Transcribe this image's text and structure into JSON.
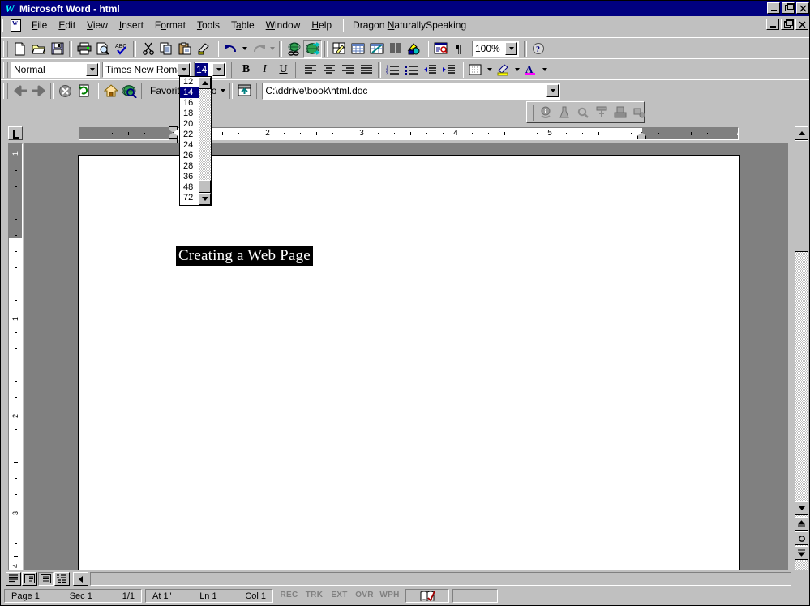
{
  "window": {
    "title": "Microsoft Word - html",
    "app_icon": "word-w-icon",
    "minimize_label": "Minimize",
    "maximize_label": "Maximize",
    "close_label": "Close",
    "doc_minimize_label": "Minimize Document",
    "doc_restore_label": "Restore Document",
    "doc_close_label": "Close Document",
    "titlebar_color": "#000080",
    "face_color": "#c0c0c0"
  },
  "menubar": {
    "items": [
      {
        "label": "File",
        "accel": "F"
      },
      {
        "label": "Edit",
        "accel": "E"
      },
      {
        "label": "View",
        "accel": "V"
      },
      {
        "label": "Insert",
        "accel": "I"
      },
      {
        "label": "Format",
        "accel": "o"
      },
      {
        "label": "Tools",
        "accel": "T"
      },
      {
        "label": "Table",
        "accel": "a"
      },
      {
        "label": "Window",
        "accel": "W"
      },
      {
        "label": "Help",
        "accel": "H"
      }
    ],
    "extra": {
      "label": "Dragon NaturallySpeaking",
      "accel": "N"
    }
  },
  "standard_toolbar": {
    "name": "Standard",
    "buttons": [
      {
        "name": "new-document-icon",
        "tip": "New"
      },
      {
        "name": "open-folder-icon",
        "tip": "Open"
      },
      {
        "name": "save-floppy-icon",
        "tip": "Save"
      },
      {
        "name": "print-icon",
        "tip": "Print"
      },
      {
        "name": "print-preview-icon",
        "tip": "Print Preview"
      },
      {
        "name": "spelling-abc-check-icon",
        "tip": "Spelling and Grammar"
      },
      {
        "name": "cut-scissors-icon",
        "tip": "Cut"
      },
      {
        "name": "copy-icon",
        "tip": "Copy"
      },
      {
        "name": "paste-clipboard-icon",
        "tip": "Paste"
      },
      {
        "name": "format-painter-brush-icon",
        "tip": "Format Painter"
      },
      {
        "name": "undo-arrow-icon",
        "tip": "Undo"
      },
      {
        "name": "redo-arrow-icon",
        "tip": "Redo"
      },
      {
        "name": "insert-hyperlink-globe-icon",
        "tip": "Insert Hyperlink"
      },
      {
        "name": "web-toolbar-globe-icon",
        "tip": "Web Toolbar"
      },
      {
        "name": "tables-and-borders-icon",
        "tip": "Tables and Borders"
      },
      {
        "name": "insert-table-icon",
        "tip": "Insert Table"
      },
      {
        "name": "insert-excel-worksheet-icon",
        "tip": "Insert Microsoft Excel Worksheet"
      },
      {
        "name": "columns-icon",
        "tip": "Columns"
      },
      {
        "name": "drawing-icon",
        "tip": "Drawing"
      },
      {
        "name": "document-map-icon",
        "tip": "Document Map"
      },
      {
        "name": "show-formatting-marks-pilcrow-icon",
        "tip": "Show/Hide"
      },
      {
        "name": "office-assistant-help-icon",
        "tip": "Microsoft Word Help"
      }
    ],
    "zoom": {
      "label": "Zoom",
      "value": "100%"
    }
  },
  "formatting_toolbar": {
    "name": "Formatting",
    "style": {
      "label": "Style",
      "value": "Normal"
    },
    "font": {
      "label": "Font",
      "value": "Times New Roman"
    },
    "font_size": {
      "label": "Font Size",
      "value": "14",
      "selected": true
    },
    "buttons": [
      {
        "name": "bold-icon",
        "tip": "Bold",
        "glyph": "B"
      },
      {
        "name": "italic-icon",
        "tip": "Italic",
        "glyph": "I"
      },
      {
        "name": "underline-icon",
        "tip": "Underline",
        "glyph": "U"
      },
      {
        "name": "align-left-icon",
        "tip": "Align Left"
      },
      {
        "name": "align-center-icon",
        "tip": "Center"
      },
      {
        "name": "align-right-icon",
        "tip": "Align Right"
      },
      {
        "name": "justify-icon",
        "tip": "Justify"
      },
      {
        "name": "numbered-list-icon",
        "tip": "Numbering"
      },
      {
        "name": "bulleted-list-icon",
        "tip": "Bullets"
      },
      {
        "name": "decrease-indent-icon",
        "tip": "Decrease Indent"
      },
      {
        "name": "increase-indent-icon",
        "tip": "Increase Indent"
      },
      {
        "name": "borders-icon",
        "tip": "Outside Border"
      },
      {
        "name": "highlight-pen-icon",
        "tip": "Highlight",
        "color": "#ffff00"
      },
      {
        "name": "font-color-icon",
        "tip": "Font Color",
        "color": "#ff00ff"
      }
    ]
  },
  "web_toolbar": {
    "name": "Web",
    "buttons": [
      {
        "name": "back-arrow-icon",
        "tip": "Back"
      },
      {
        "name": "forward-arrow-icon",
        "tip": "Forward"
      },
      {
        "name": "stop-icon",
        "tip": "Stop Current Jump"
      },
      {
        "name": "refresh-icon",
        "tip": "Refresh Current Page"
      },
      {
        "name": "home-icon",
        "tip": "Start Page"
      },
      {
        "name": "search-web-icon",
        "tip": "Search the Web"
      }
    ],
    "favorites": {
      "label": "Favorites"
    },
    "go": {
      "label": "Go"
    },
    "show_only_web_toolbar": {
      "name": "show-only-web-toolbar-icon",
      "tip": "Show Only Web Toolbar"
    },
    "address": {
      "label": "Address",
      "value": "C:\\ddrive\\book\\html.doc"
    }
  },
  "font_size_dropdown": {
    "open": true,
    "selected": "14",
    "items": [
      "12",
      "14",
      "16",
      "18",
      "20",
      "22",
      "24",
      "26",
      "28",
      "36",
      "48",
      "72"
    ]
  },
  "floating_toolbar": {
    "name": "Dragon NaturallySpeaking toolbar",
    "disabled": true,
    "buttons": [
      {
        "name": "microphone-info-icon"
      },
      {
        "name": "voice-train-icon"
      },
      {
        "name": "search-magnifier-icon"
      },
      {
        "name": "voice-command-icon"
      },
      {
        "name": "playback-icon"
      },
      {
        "name": "transcribe-icon"
      }
    ]
  },
  "ruler": {
    "horizontal": {
      "unit": "inch",
      "numbers": [
        "1",
        "2",
        "3",
        "4",
        "5",
        "7"
      ],
      "left_margin_in": 1.0,
      "right_indent_in": 6.5,
      "max_in": 7.4
    },
    "vertical": {
      "numbers": [
        "1",
        "2",
        "3",
        "4"
      ],
      "top_margin_in": 1.0
    }
  },
  "document": {
    "heading": "Creating a Web Page",
    "heading_selected": true,
    "page_background": "#ffffff",
    "workspace_background": "#808080"
  },
  "view_buttons": [
    {
      "name": "normal-view-button",
      "tip": "Normal View",
      "active": false
    },
    {
      "name": "online-layout-view-button",
      "tip": "Online Layout View",
      "active": false
    },
    {
      "name": "page-layout-view-button",
      "tip": "Page Layout View",
      "active": true
    },
    {
      "name": "outline-view-button",
      "tip": "Outline View",
      "active": false
    }
  ],
  "scrollbar": {
    "up_button": "scroll-up-button",
    "down_button": "scroll-down-button",
    "previous_page_button": "previous-page-button",
    "select_browse_object_button": "select-browse-object-button",
    "next_page_button": "next-page-button"
  },
  "statusbar": {
    "page": "Page 1",
    "section": "Sec 1",
    "pages": "1/1",
    "at": "At 1\"",
    "line": "Ln 1",
    "column": "Col 1",
    "flags": [
      {
        "label": "REC",
        "enabled": false
      },
      {
        "label": "TRK",
        "enabled": false
      },
      {
        "label": "EXT",
        "enabled": false
      },
      {
        "label": "OVR",
        "enabled": false
      },
      {
        "label": "WPH",
        "enabled": false
      }
    ],
    "spell_icon": "spelling-status-icon",
    "blank_cell": ""
  }
}
